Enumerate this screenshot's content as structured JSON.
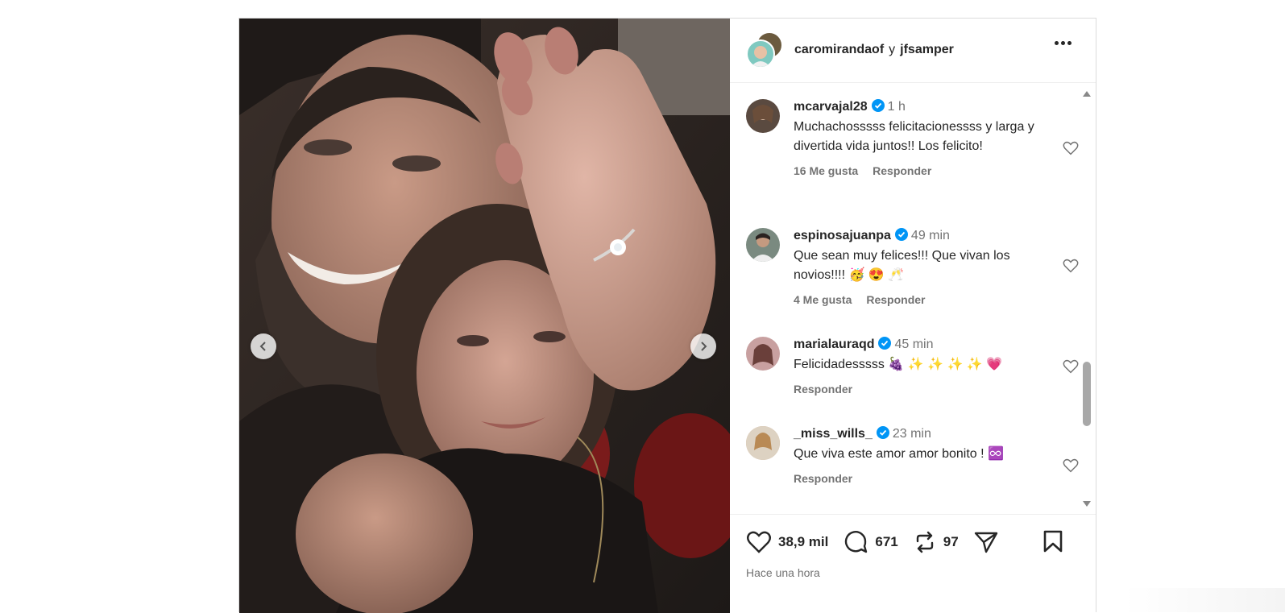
{
  "header": {
    "user1": "caromirandaof",
    "joiner": "y",
    "user2": "jfsamper",
    "more_icon": "more-horizontal-icon"
  },
  "carousel": {
    "prev_icon": "chevron-left-icon",
    "next_icon": "chevron-right-icon"
  },
  "comments": [
    {
      "user": "mcarvajal28",
      "time": "1 h",
      "text": "Muchachosssss felicitacionessss y larga y divertida vida juntos!! Los felicito!",
      "likes": "16 Me gusta",
      "reply": "Responder",
      "avatar_color": "#5a4a40"
    },
    {
      "user": "espinosajuanpa",
      "time": "49 min",
      "text": "Que sean muy felices!!! Que vivan los novios!!!! 🥳 😍 🥂",
      "likes": "4 Me gusta",
      "reply": "Responder",
      "avatar_color": "#7a8a80"
    },
    {
      "user": "marialauraqd",
      "time": "45 min",
      "text": "Felicidadesssss 🍇 ✨ ✨ ✨ ✨ 💗",
      "likes": "",
      "reply": "Responder",
      "avatar_color": "#c8a0a0"
    },
    {
      "user": "_miss_wills_",
      "time": "23 min",
      "text": "Que viva este amor amor bonito ! ♾️",
      "likes": "",
      "reply": "Responder",
      "avatar_color": "#c9a27a"
    }
  ],
  "actions": {
    "likes_count": "38,9 mil",
    "comments_count": "671",
    "reposts_count": "97",
    "posted": "Hace una hora"
  },
  "colors": {
    "verified": "#0095f6",
    "text": "#262626",
    "muted": "#737373",
    "border": "#dbdbdb"
  }
}
